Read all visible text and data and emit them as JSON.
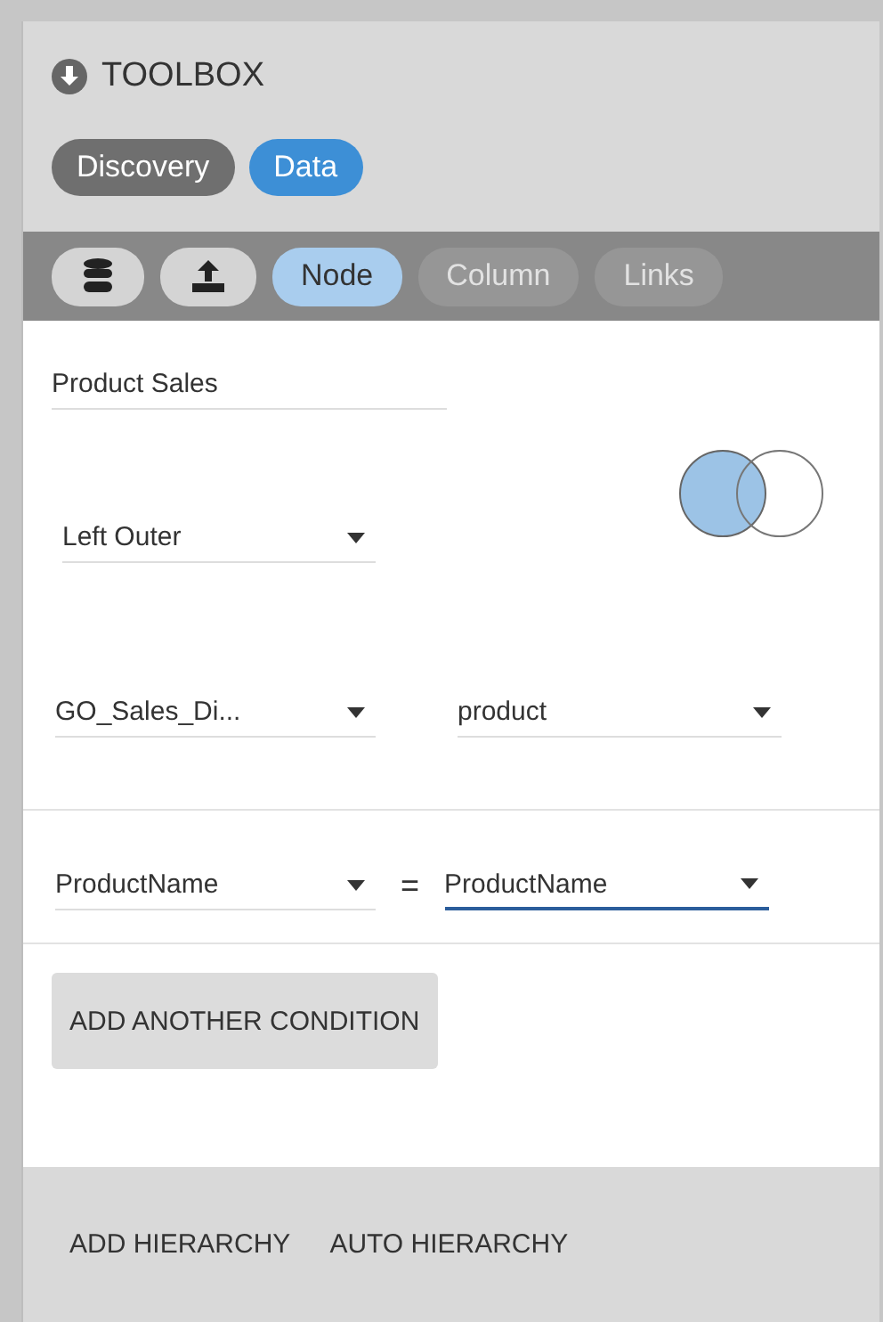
{
  "header": {
    "title": "TOOLBOX"
  },
  "tabs": [
    {
      "label": "Discovery",
      "selected": false
    },
    {
      "label": "Data",
      "selected": true
    }
  ],
  "toolbar": [
    {
      "kind": "database",
      "selected": false,
      "disabled": false
    },
    {
      "kind": "upload",
      "selected": false,
      "disabled": false
    },
    {
      "kind": "text",
      "label": "Node",
      "selected": true,
      "disabled": false
    },
    {
      "kind": "text",
      "label": "Column",
      "selected": false,
      "disabled": true
    },
    {
      "kind": "text",
      "label": "Links",
      "selected": false,
      "disabled": true
    }
  ],
  "node_name": {
    "value": "Product Sales"
  },
  "join_type": {
    "value": "Left Outer",
    "venn": {
      "left_filled": true,
      "right_filled": false
    }
  },
  "tables": [
    {
      "value": "GO_Sales_Di...",
      "focused": false
    },
    {
      "value": "product",
      "focused": false
    }
  ],
  "condition": {
    "left": {
      "value": "ProductName",
      "focused": false
    },
    "operator": "=",
    "right": {
      "value": "ProductName",
      "focused": true
    }
  },
  "add_condition_button": "ADD ANOTHER CONDITION",
  "footer_buttons": [
    "ADD HIERARCHY",
    "AUTO HIERARCHY"
  ]
}
